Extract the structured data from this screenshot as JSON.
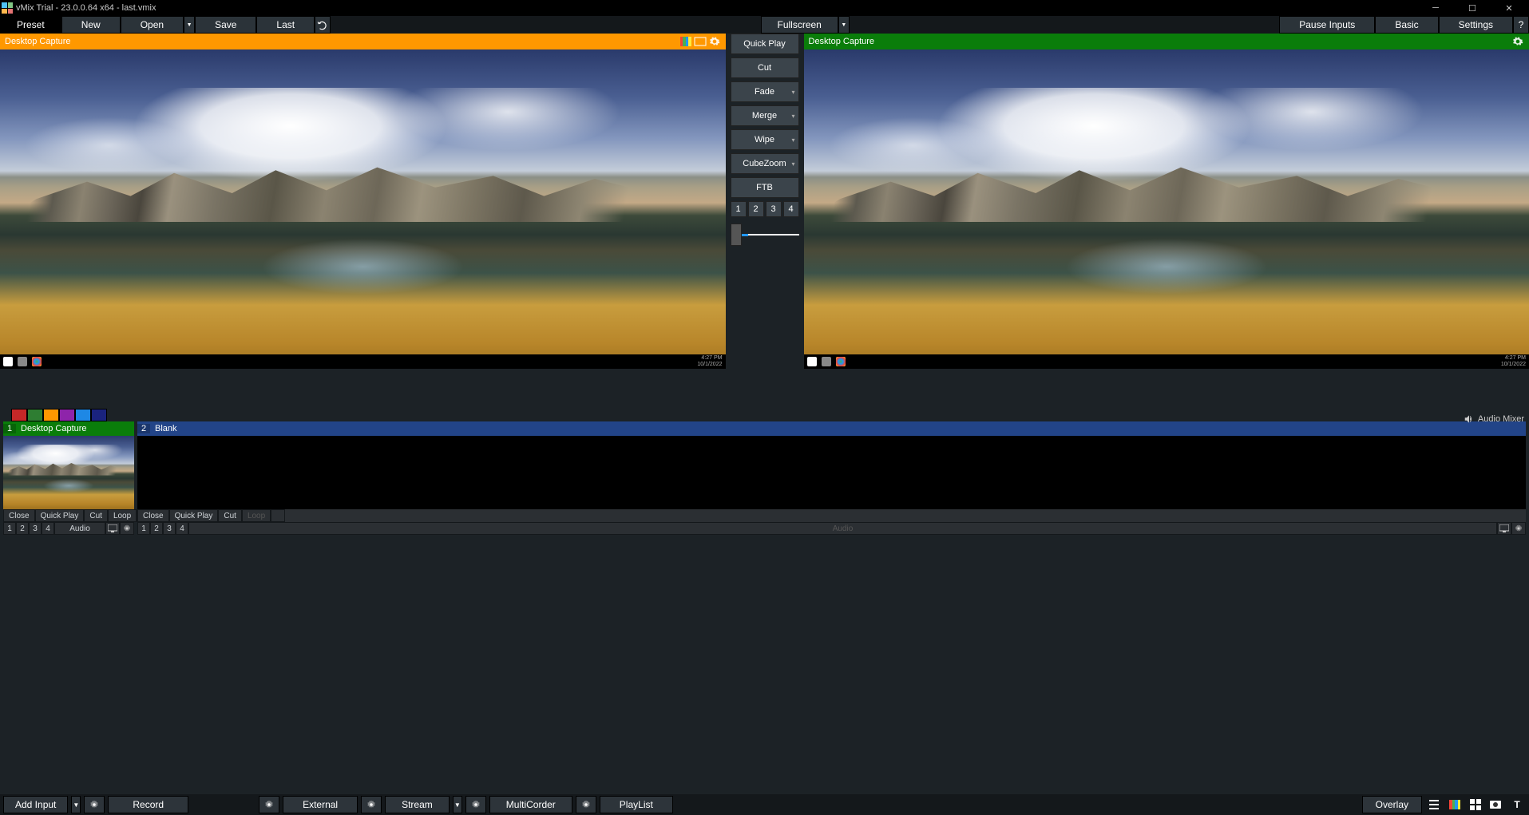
{
  "app": {
    "title": "vMix Trial - 23.0.0.64 x64 - last.vmix"
  },
  "toolbar": {
    "preset": "Preset",
    "new": "New",
    "open": "Open",
    "save": "Save",
    "last": "Last",
    "fullscreen": "Fullscreen",
    "pause_inputs": "Pause Inputs",
    "basic": "Basic",
    "settings": "Settings",
    "help": "?"
  },
  "preview": {
    "label": "Desktop Capture"
  },
  "program": {
    "label": "Desktop Capture"
  },
  "transitions": {
    "quick_play": "Quick Play",
    "cut": "Cut",
    "fade": "Fade",
    "merge": "Merge",
    "wipe": "Wipe",
    "cubezoom": "CubeZoom",
    "ftb": "FTB",
    "nums": [
      "1",
      "2",
      "3",
      "4"
    ]
  },
  "swatches": [
    "#c62828",
    "#2e7d32",
    "#ff9800",
    "#8e24aa",
    "#1e88e5",
    "#1a237e"
  ],
  "inputs": [
    {
      "num": "1",
      "label": "Desktop Capture",
      "state": "active",
      "thumb": "landscape",
      "row1": [
        "Close",
        "Quick Play",
        "Cut",
        "Loop"
      ],
      "pause": true,
      "row2nums": [
        "1",
        "2",
        "3",
        "4"
      ],
      "audio": "Audio"
    },
    {
      "num": "2",
      "label": "Blank",
      "state": "preview",
      "thumb": "blank",
      "row1": [
        "Close",
        "Quick Play",
        "Cut",
        "Loop"
      ],
      "pause": false,
      "loopdisabled": true,
      "row2nums": [
        "1",
        "2",
        "3",
        "4"
      ],
      "audio": "Audio",
      "audiodisabled": true
    }
  ],
  "audiomixer": "Audio Mixer",
  "bottom": {
    "add_input": "Add Input",
    "record": "Record",
    "external": "External",
    "stream": "Stream",
    "multicorder": "MultiCorder",
    "playlist": "PlayList",
    "overlay": "Overlay"
  }
}
